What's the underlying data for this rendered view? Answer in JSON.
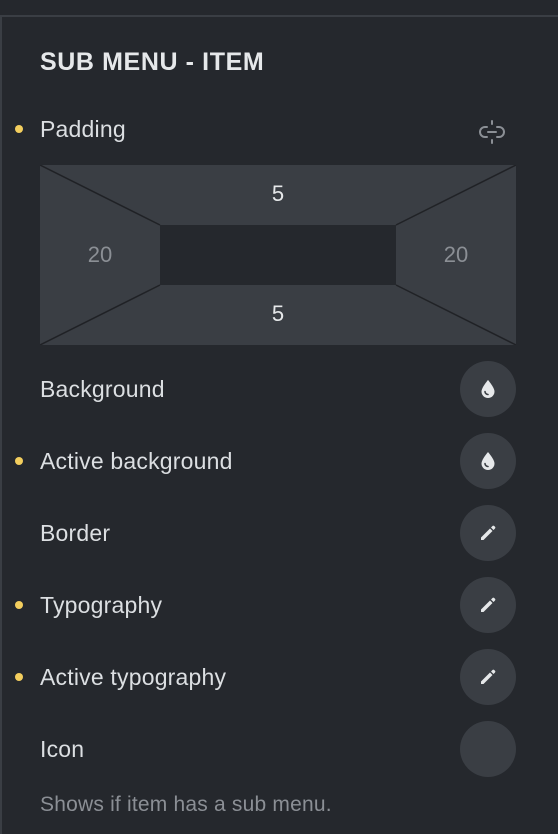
{
  "section": {
    "title": "SUB MENU - ITEM"
  },
  "padding": {
    "label": "Padding",
    "modified": true,
    "link_icon": "unlink-icon",
    "top": "5",
    "right": "20",
    "bottom": "5",
    "left": "20"
  },
  "controls": [
    {
      "label": "Background",
      "modified": false,
      "icon": "color-drop-icon"
    },
    {
      "label": "Active background",
      "modified": true,
      "icon": "color-drop-icon"
    },
    {
      "label": "Border",
      "modified": false,
      "icon": "pencil-icon"
    },
    {
      "label": "Typography",
      "modified": true,
      "icon": "pencil-icon"
    },
    {
      "label": "Active typography",
      "modified": true,
      "icon": "pencil-icon"
    },
    {
      "label": "Icon",
      "modified": false,
      "icon": "empty"
    }
  ],
  "icon_hint": "Shows if item has a sub menu.",
  "colors": {
    "background": "#25282d",
    "control": "#3a3e44",
    "modified_dot": "#f3ce5e",
    "text": "#dcdfe2",
    "muted_text": "#8b8f95"
  }
}
